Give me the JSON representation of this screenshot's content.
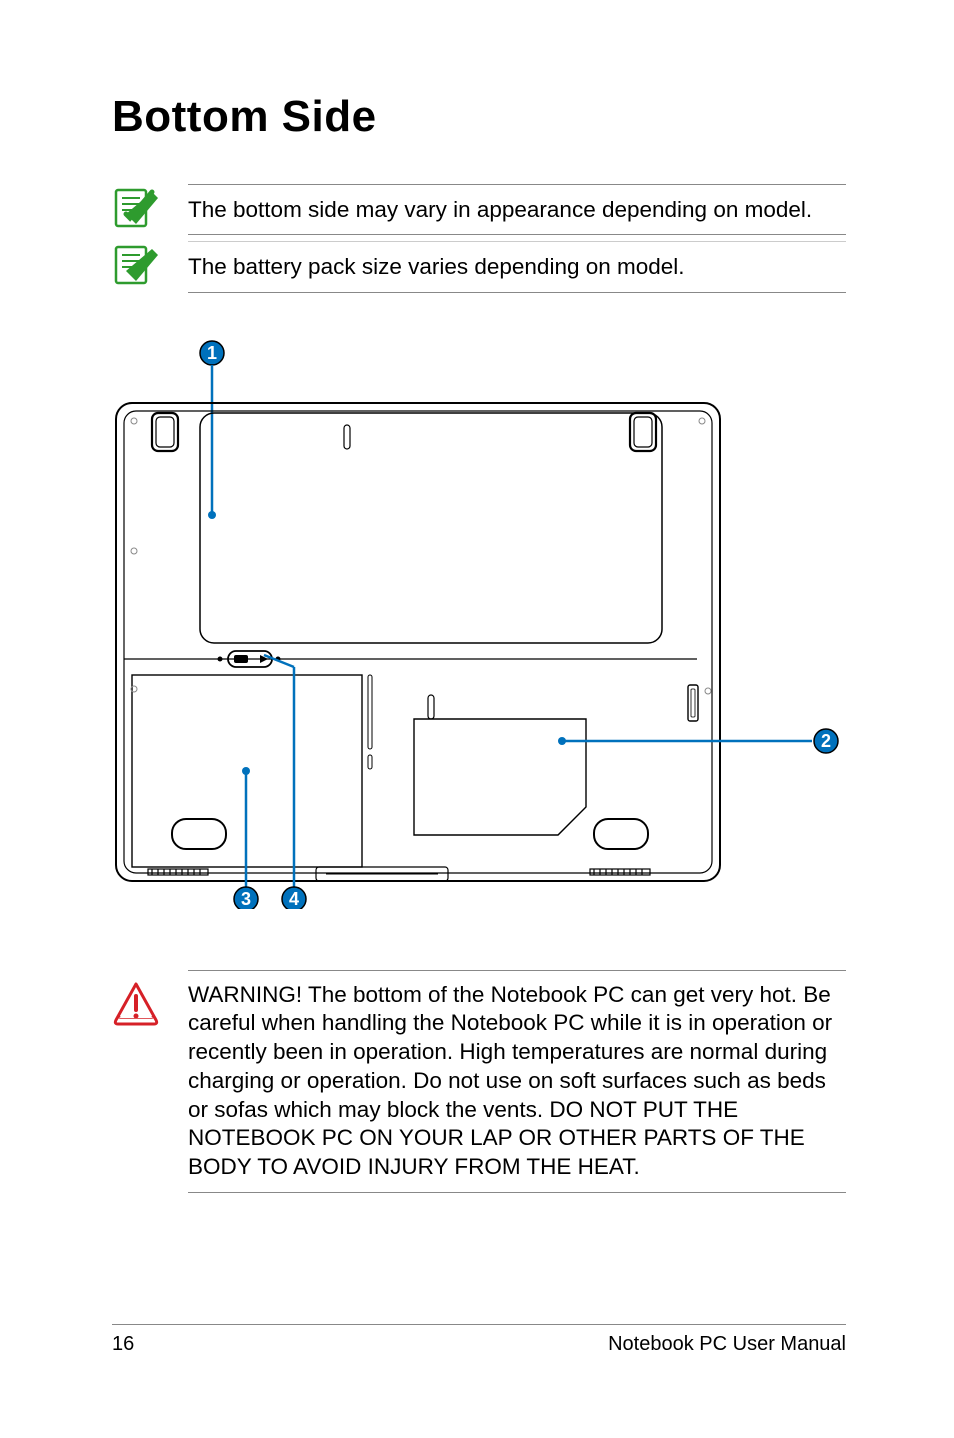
{
  "title": "Bottom Side",
  "notes": [
    "The bottom side may vary in appearance depending on model.",
    "The battery pack size varies depending on model."
  ],
  "callouts": {
    "1": "1",
    "2": "2",
    "3": "3",
    "4": "4"
  },
  "warning": "WARNING!  The bottom of the Notebook PC can get very hot. Be careful when handling the Notebook PC while it is in operation or recently been in operation. High temperatures are normal during charging or operation. Do not use on soft surfaces such as beds or sofas which may block the vents. DO NOT PUT THE NOTEBOOK PC ON YOUR LAP OR OTHER PARTS OF THE BODY TO AVOID INJURY FROM THE HEAT.",
  "footer": {
    "page_number": "16",
    "doc_title": "Notebook PC User Manual"
  }
}
